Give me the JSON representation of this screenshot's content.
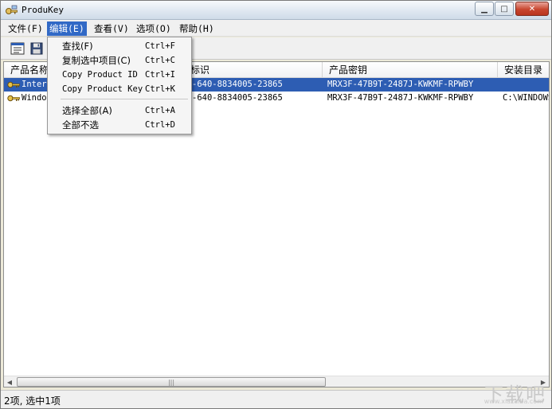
{
  "window": {
    "title": "ProduKey",
    "minimize": "▁",
    "maximize": "□",
    "close": "✕"
  },
  "menubar": {
    "items": [
      {
        "label": "文件(F)"
      },
      {
        "label": "编辑(E)"
      },
      {
        "label": "查看(V)"
      },
      {
        "label": "选项(O)"
      },
      {
        "label": "帮助(H)"
      }
    ]
  },
  "edit_menu": {
    "items": [
      {
        "label": "查找(F)",
        "shortcut": "Ctrl+F"
      },
      {
        "label": "复制选中项目(C)",
        "shortcut": "Ctrl+C"
      },
      {
        "label": "Copy Product ID",
        "shortcut": "Ctrl+I"
      },
      {
        "label": "Copy Product Key",
        "shortcut": "Ctrl+K"
      },
      {
        "label": "选择全部(A)",
        "shortcut": "Ctrl+A"
      },
      {
        "label": "全部不选",
        "shortcut": "Ctrl+D"
      }
    ]
  },
  "list": {
    "columns": [
      "产品名称",
      "标识",
      "产品密钥",
      "安装目录"
    ],
    "rows": [
      {
        "name": "Inter",
        "id": "-640-8834005-23865",
        "key": "MRX3F-47B9T-2487J-KWKMF-RPWBY",
        "dir": ""
      },
      {
        "name": "Windo",
        "id": "-640-8834005-23865",
        "key": "MRX3F-47B9T-2487J-KWKMF-RPWBY",
        "dir": "C:\\WINDOWS"
      }
    ]
  },
  "status": {
    "text": "2项, 选中1项"
  },
  "icons": {
    "app": "key-icon",
    "toolbar": [
      "properties-icon",
      "save-icon"
    ],
    "row": "key-icon"
  },
  "colors": {
    "selection": "#2d5db3",
    "menu_active": "#3169c6"
  },
  "watermark": {
    "text": "下载吧",
    "sub": "www.xiazaiba.com"
  }
}
